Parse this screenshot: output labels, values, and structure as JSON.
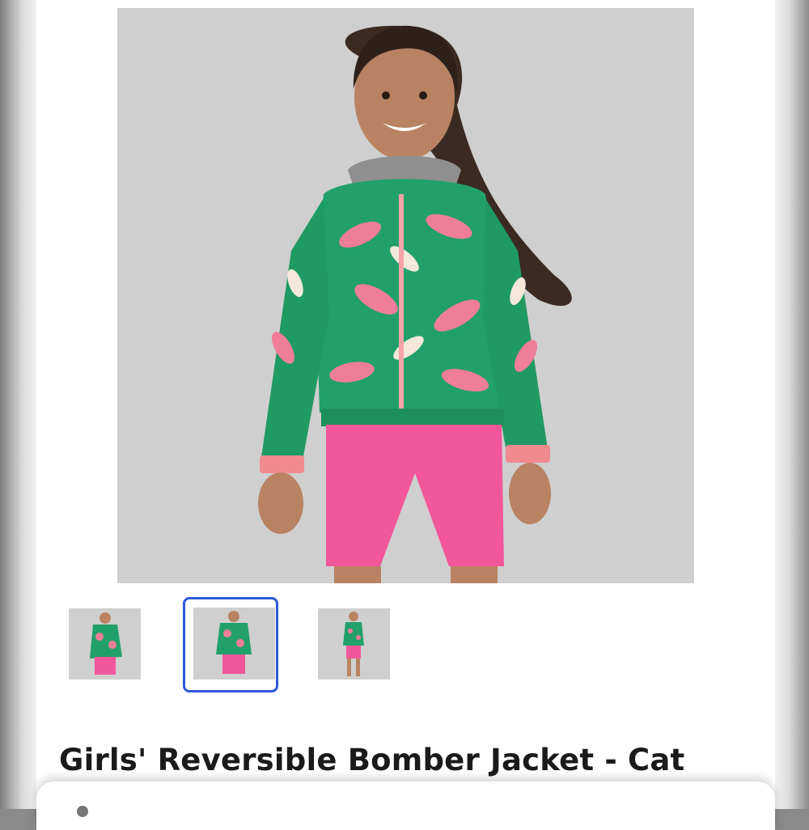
{
  "product": {
    "title": "Girls' Reversible Bomber Jacket - Cat",
    "main_image": "model-in-green-butterfly-print-jacket-and-pink-shorts",
    "thumbnails": [
      {
        "image": "thumbnail-side-view",
        "selected": false
      },
      {
        "image": "thumbnail-front-view",
        "selected": true
      },
      {
        "image": "thumbnail-full-body-view",
        "selected": false
      }
    ]
  },
  "colors": {
    "selected_thumbnail_border": "#2c59d8",
    "jacket_green": "#22a06b",
    "shorts_pink": "#f2579a",
    "backdrop_gray": "#cfcfcf"
  }
}
